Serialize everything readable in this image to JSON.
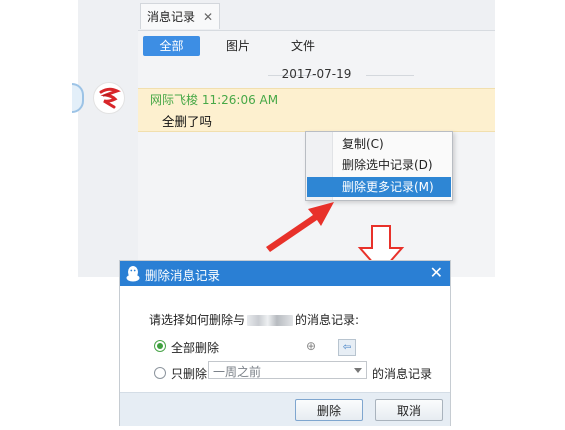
{
  "history_window": {
    "tab_label": "消息记录",
    "filter_tabs": [
      "全部",
      "图片",
      "文件"
    ],
    "date_divider": "2017-07-19",
    "message": {
      "sender_time": "网际飞梭 11:26:06 AM",
      "text": "全删了吗"
    }
  },
  "context_menu": {
    "items": [
      "复制(C)",
      "删除选中记录(D)",
      "删除更多记录(M)"
    ],
    "highlighted_index": 2
  },
  "dialog": {
    "title": "删除消息记录",
    "prompt_prefix": "请选择如何删除与",
    "prompt_suffix": "的消息记录:",
    "option_all_label": "全部删除",
    "option_only_label": "只删除",
    "range_select_value": "一周之前",
    "range_suffix": "的消息记录",
    "delete_button": "删除",
    "cancel_button": "取消",
    "selected_option": "全部删除"
  },
  "colors": {
    "accent_blue": "#2a7fd4",
    "menu_highlight": "#2e86d4",
    "message_bg": "#fdf0cf",
    "sender_green": "#47a847",
    "annotation_red": "#e8312a"
  },
  "icons": [
    "close-icon",
    "qq-penguin-icon",
    "avatar-icon",
    "move-icon",
    "image-thumbnail-icon",
    "dropdown-arrow-icon"
  ]
}
